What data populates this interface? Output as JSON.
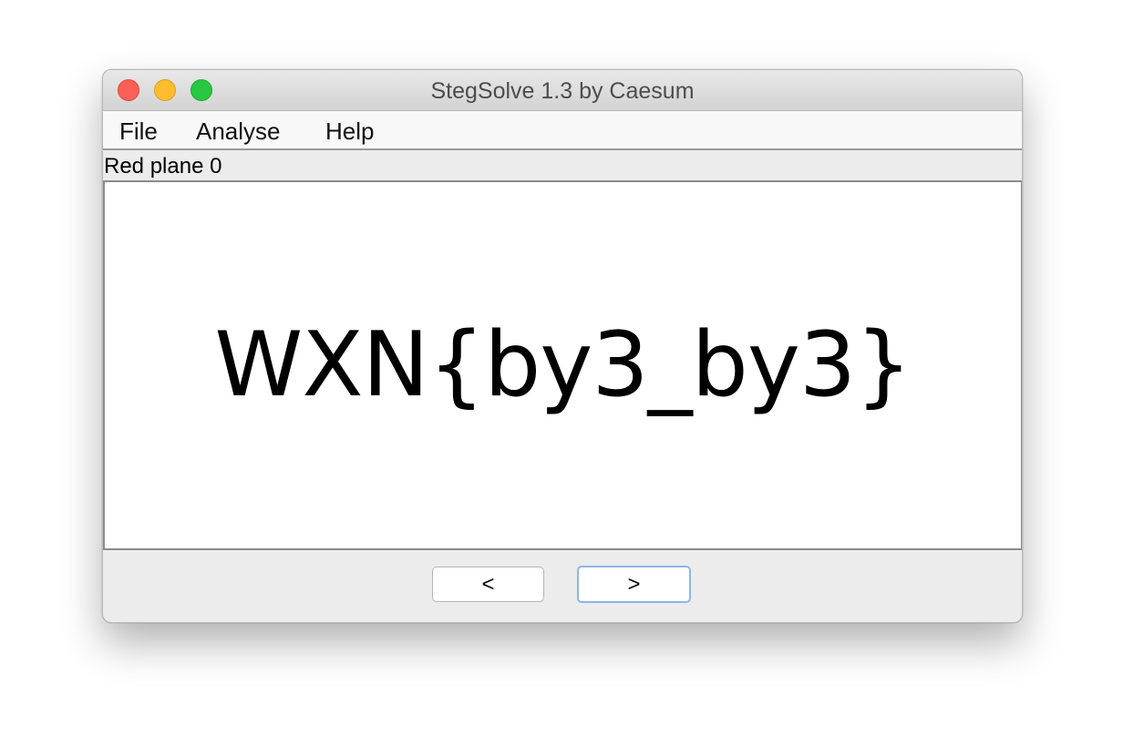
{
  "window": {
    "title": "StegSolve 1.3 by Caesum"
  },
  "menu": {
    "items": [
      "File",
      "Analyse",
      "Help"
    ]
  },
  "plane": {
    "label": "Red plane 0"
  },
  "image": {
    "text": "WXN{by3_by3}"
  },
  "nav": {
    "prev_label": "<",
    "next_label": ">"
  },
  "colors": {
    "close": "#fe5f57",
    "minimize": "#febc2e",
    "zoom": "#28c840",
    "focus_ring": "#8eb5e8"
  }
}
